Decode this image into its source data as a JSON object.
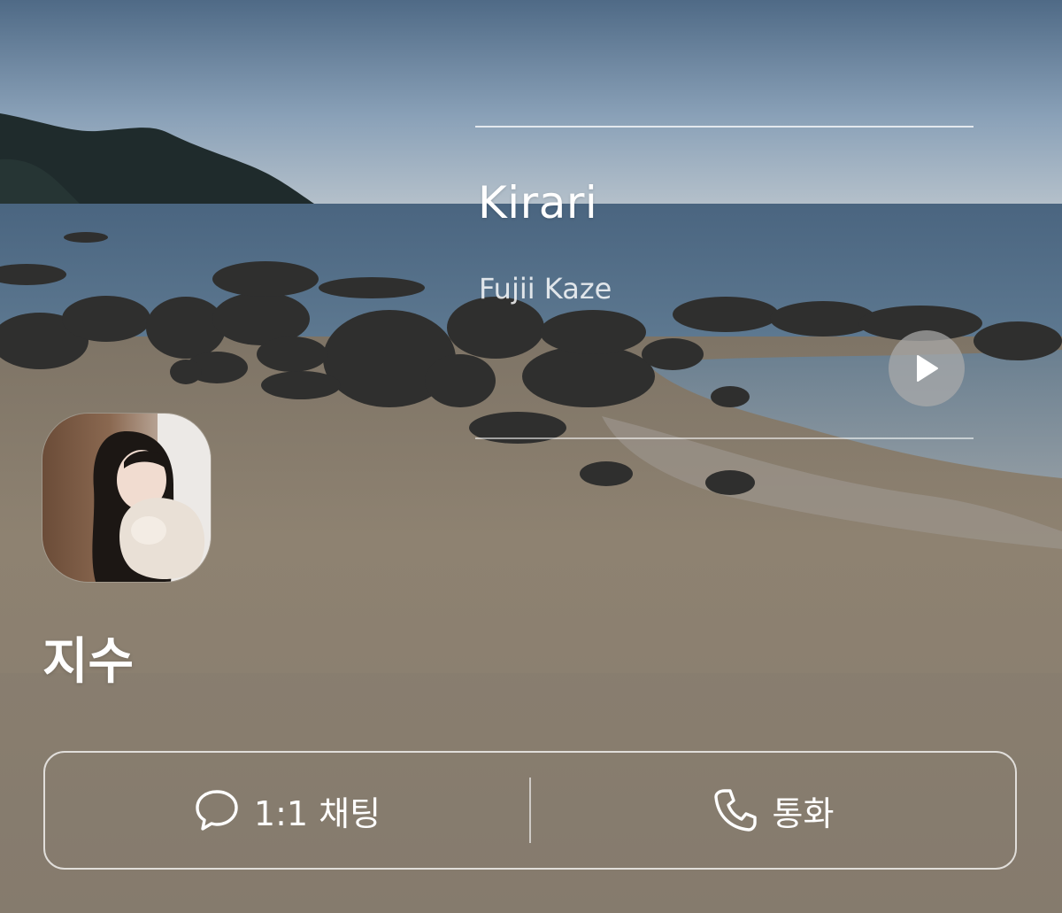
{
  "music": {
    "title": "Kirari",
    "artist": "Fujii Kaze",
    "play_icon": "play-icon"
  },
  "profile": {
    "name": "지수",
    "avatar_icon": "profile-photo"
  },
  "actions": {
    "chat_label": "1:1 채팅",
    "chat_icon": "chat-bubble-icon",
    "call_label": "통화",
    "call_icon": "phone-icon"
  },
  "colors": {
    "sky_top": "#5f7a94",
    "sea": "#4f6d86",
    "sand": "#8c8070",
    "text": "#ffffff"
  }
}
